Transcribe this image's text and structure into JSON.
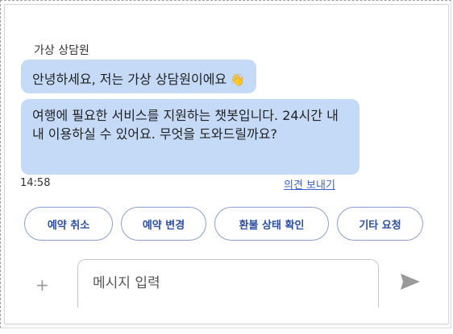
{
  "chat": {
    "sender_name": "가상 상담원",
    "messages": [
      {
        "text": "안녕하세요, 저는 가상 상담원이에요",
        "emoji": "👋"
      },
      {
        "text": "여행에 필요한 서비스를 지원하는 챗봇입니다. 24시간 내내 이용하실 수 있어요. 무엇을 도와드릴까요?"
      }
    ],
    "timestamp": "14:58",
    "feedback_link": "의견 보내기"
  },
  "quick_replies": [
    {
      "label": "예약 취소"
    },
    {
      "label": "예약 변경"
    },
    {
      "label": "환불 상태 확인"
    },
    {
      "label": "기타 요청"
    }
  ],
  "composer": {
    "plus_icon": "+",
    "placeholder": "메시지 입력",
    "send_icon": "send-icon"
  },
  "colors": {
    "bubble": "#c5daf7",
    "chip_text": "#2c4ea3",
    "chip_border": "#8aa1cf",
    "link": "#3b63c9"
  }
}
